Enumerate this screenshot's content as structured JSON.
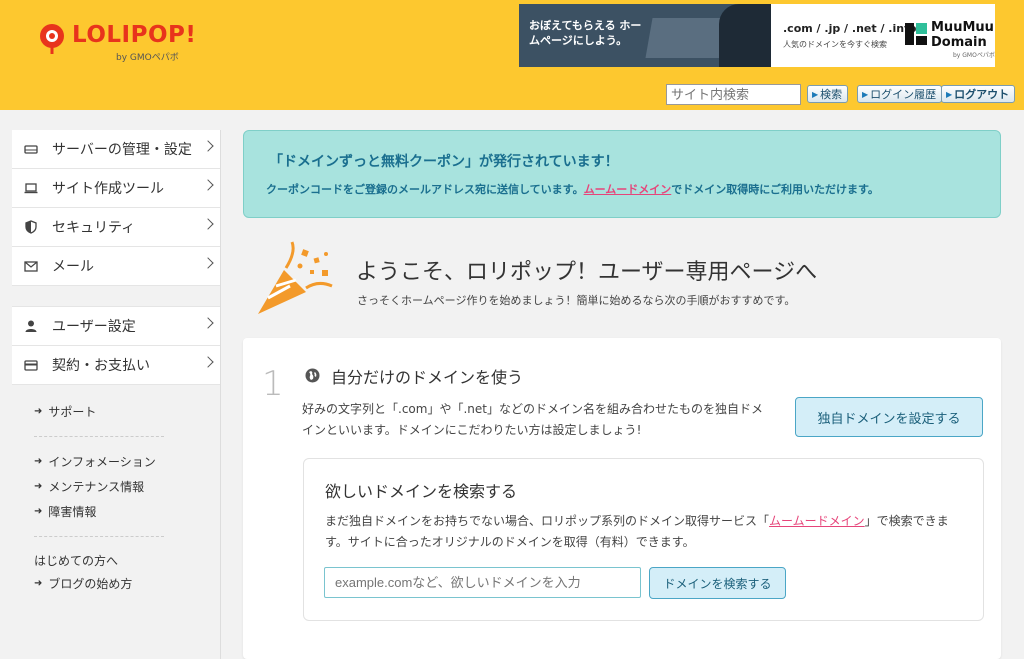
{
  "header": {
    "logo_text": "LOLIPOP!",
    "logo_sub": "by GMOペパボ",
    "ad_left_text": "おぼえてもらえる ホームページにしよう。",
    "ad_right_tlds": ".com / .jp / .net / .info",
    "ad_right_tagline": "人気のドメインを今すぐ検索",
    "ad_right_brand_line1": "MuuMuu",
    "ad_right_brand_line2": "Domain",
    "ad_right_brand_sub": "by GMOペパボ",
    "search_placeholder": "サイト内検索",
    "search_button": "検索",
    "login_history_button": "ログイン履歴",
    "logout_button": "ログアウト",
    "colors": {
      "header_bg": "#fdc82f",
      "logo": "#e8341c"
    }
  },
  "sidebar": {
    "items": [
      {
        "label": "サーバーの管理・設定",
        "icon": "server-icon"
      },
      {
        "label": "サイト作成ツール",
        "icon": "laptop-icon"
      },
      {
        "label": "セキュリティ",
        "icon": "shield-icon"
      },
      {
        "label": "メール",
        "icon": "mail-icon"
      }
    ],
    "items2": [
      {
        "label": "ユーザー設定",
        "icon": "user-icon"
      },
      {
        "label": "契約・お支払い",
        "icon": "credit-card-icon"
      }
    ],
    "support": "サポート",
    "info": "インフォメーション",
    "maintenance": "メンテナンス情報",
    "failure": "障害情報",
    "beginners_heading": "はじめての方へ",
    "blog_start": "ブログの始め方"
  },
  "notice": {
    "title": "「ドメインずっと無料クーポン」が発行されています！",
    "text_before": "クーポンコードをご登録のメールアドレス宛に送信しています。",
    "link": "ムームードメイン",
    "text_after": "でドメイン取得時にご利用いただけます。",
    "colors": {
      "bg": "#a8e3de",
      "text": "#1a6f8f",
      "link": "#e6457a"
    }
  },
  "welcome": {
    "title": "ようこそ、ロリポップ！ユーザー専用ページへ",
    "subtitle": "さっそくホームページ作りを始めましょう！簡単に始めるなら次の手順がおすすめです。"
  },
  "step1": {
    "number": "1",
    "title": "自分だけのドメインを使う",
    "description": "好みの文字列と「.com」や「.net」などのドメイン名を組み合わせたものを独自ドメインといいます。ドメインにこだわりたい方は設定しましょう!",
    "button": "独自ドメインを設定する"
  },
  "domain_search": {
    "title": "欲しいドメインを検索する",
    "desc_before": "まだ独自ドメインをお持ちでない場合、ロリポップ系列のドメイン取得サービス「",
    "desc_link": "ムームードメイン",
    "desc_after": "」で検索できます。サイトに合ったオリジナルのドメインを取得（有料）できます。",
    "input_placeholder": "example.comなど、欲しいドメインを入力",
    "button": "ドメインを検索する"
  }
}
